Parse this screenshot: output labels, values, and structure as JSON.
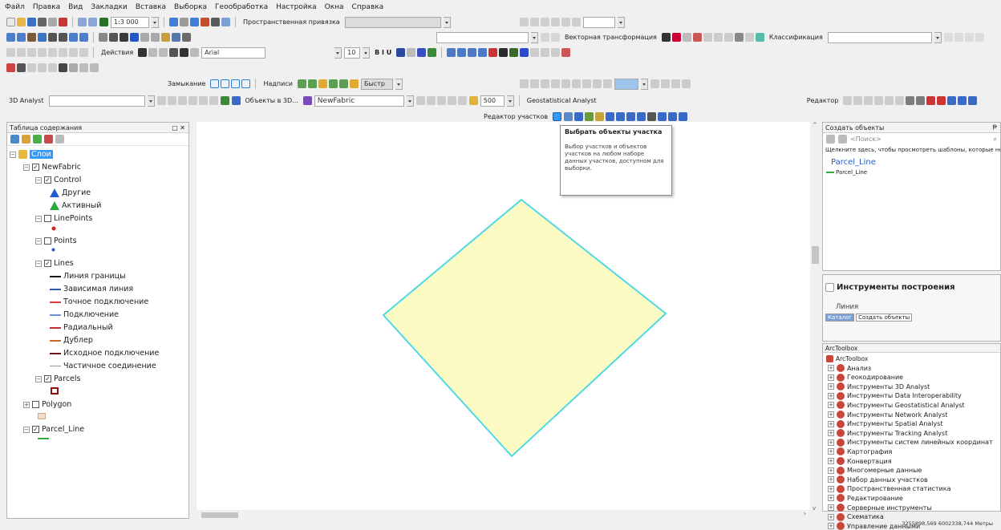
{
  "menu": [
    "Файл",
    "Правка",
    "Вид",
    "Закладки",
    "Вставка",
    "Выборка",
    "Геообработка",
    "Настройка",
    "Окна",
    "Справка"
  ],
  "toolbar": {
    "scale": "1:3 000",
    "snapping": "Пространственная привязка",
    "vector_transform": "Векторная трансформация",
    "classification": "Классификация",
    "actions": "Действия",
    "font": "Arial",
    "font_size": "10",
    "closure": "Замыкание",
    "labels": "Надписи",
    "fast": "Быстр",
    "analyst_3d": "3D Analyst",
    "objects_3d": "Объекты в 3D...",
    "fabric": "NewFabric",
    "value_500": "500",
    "geostat": "Geostatistical Analyst",
    "editor": "Редактор",
    "parcel_editor": "Редактор участков"
  },
  "tooltip": {
    "title": "Выбрать объекты участка",
    "body": "Выбор участков и объектов участков на любом наборе данных участков, доступном для выборки."
  },
  "toc": {
    "title": "Таблица содержания",
    "layers_root": "Слои",
    "fabric": "NewFabric",
    "control": "Control",
    "other": "Другие",
    "active": "Активный",
    "linepoints": "LinePoints",
    "points": "Points",
    "lines": "Lines",
    "line_items": [
      {
        "label": "Линия границы",
        "color": "#1a1a1a"
      },
      {
        "label": "Зависимая линия",
        "color": "#2f5aa8"
      },
      {
        "label": "Точное подключение",
        "color": "#d93b3b"
      },
      {
        "label": "Подключение",
        "color": "#6f8fcf"
      },
      {
        "label": "Радиальный",
        "color": "#c42c2c"
      },
      {
        "label": "Дублер",
        "color": "#c76a2a"
      },
      {
        "label": "Исходное подключение",
        "color": "#6a1616"
      },
      {
        "label": "Частичное соединение",
        "color": "#9a9a9a"
      }
    ],
    "parcels": "Parcels",
    "polygon": "Polygon",
    "parcel_line": "Parcel_Line"
  },
  "create_features": {
    "title": "Создать объекты",
    "search_placeholder": "<Поиск>",
    "hint": "Щелкните здесь, чтобы просмотреть шаблоны, которые не",
    "group": "Parcel_Line",
    "item": "Parcel_Line"
  },
  "construction": {
    "title": "Инструменты построения",
    "tool": "Линия",
    "tab_catalog": "Каталог",
    "tab_create": "Создать объекты"
  },
  "arctoolbox": {
    "title": "ArcToolbox",
    "root": "ArcToolbox",
    "items": [
      "Анализ",
      "Геокодирование",
      "Инструменты 3D Analyst",
      "Инструменты Data Interoperability",
      "Инструменты Geostatistical Analyst",
      "Инструменты Network Analyst",
      "Инструменты Spatial Analyst",
      "Инструменты Tracking Analyst",
      "Инструменты систем линейных координат",
      "Картография",
      "Конвертация",
      "Многомерные данные",
      "Набор данных участков",
      "Пространственная статистика",
      "Редактирование",
      "Серверные инструменты",
      "Схематика",
      "Управление данными"
    ]
  },
  "status": {
    "coords": "3255898,569  6002338,744 Метры"
  },
  "colors": {
    "parcel_fill": "#fdfbc4",
    "parcel_stroke": "#4fd8e8",
    "selection": "#3399ff"
  }
}
